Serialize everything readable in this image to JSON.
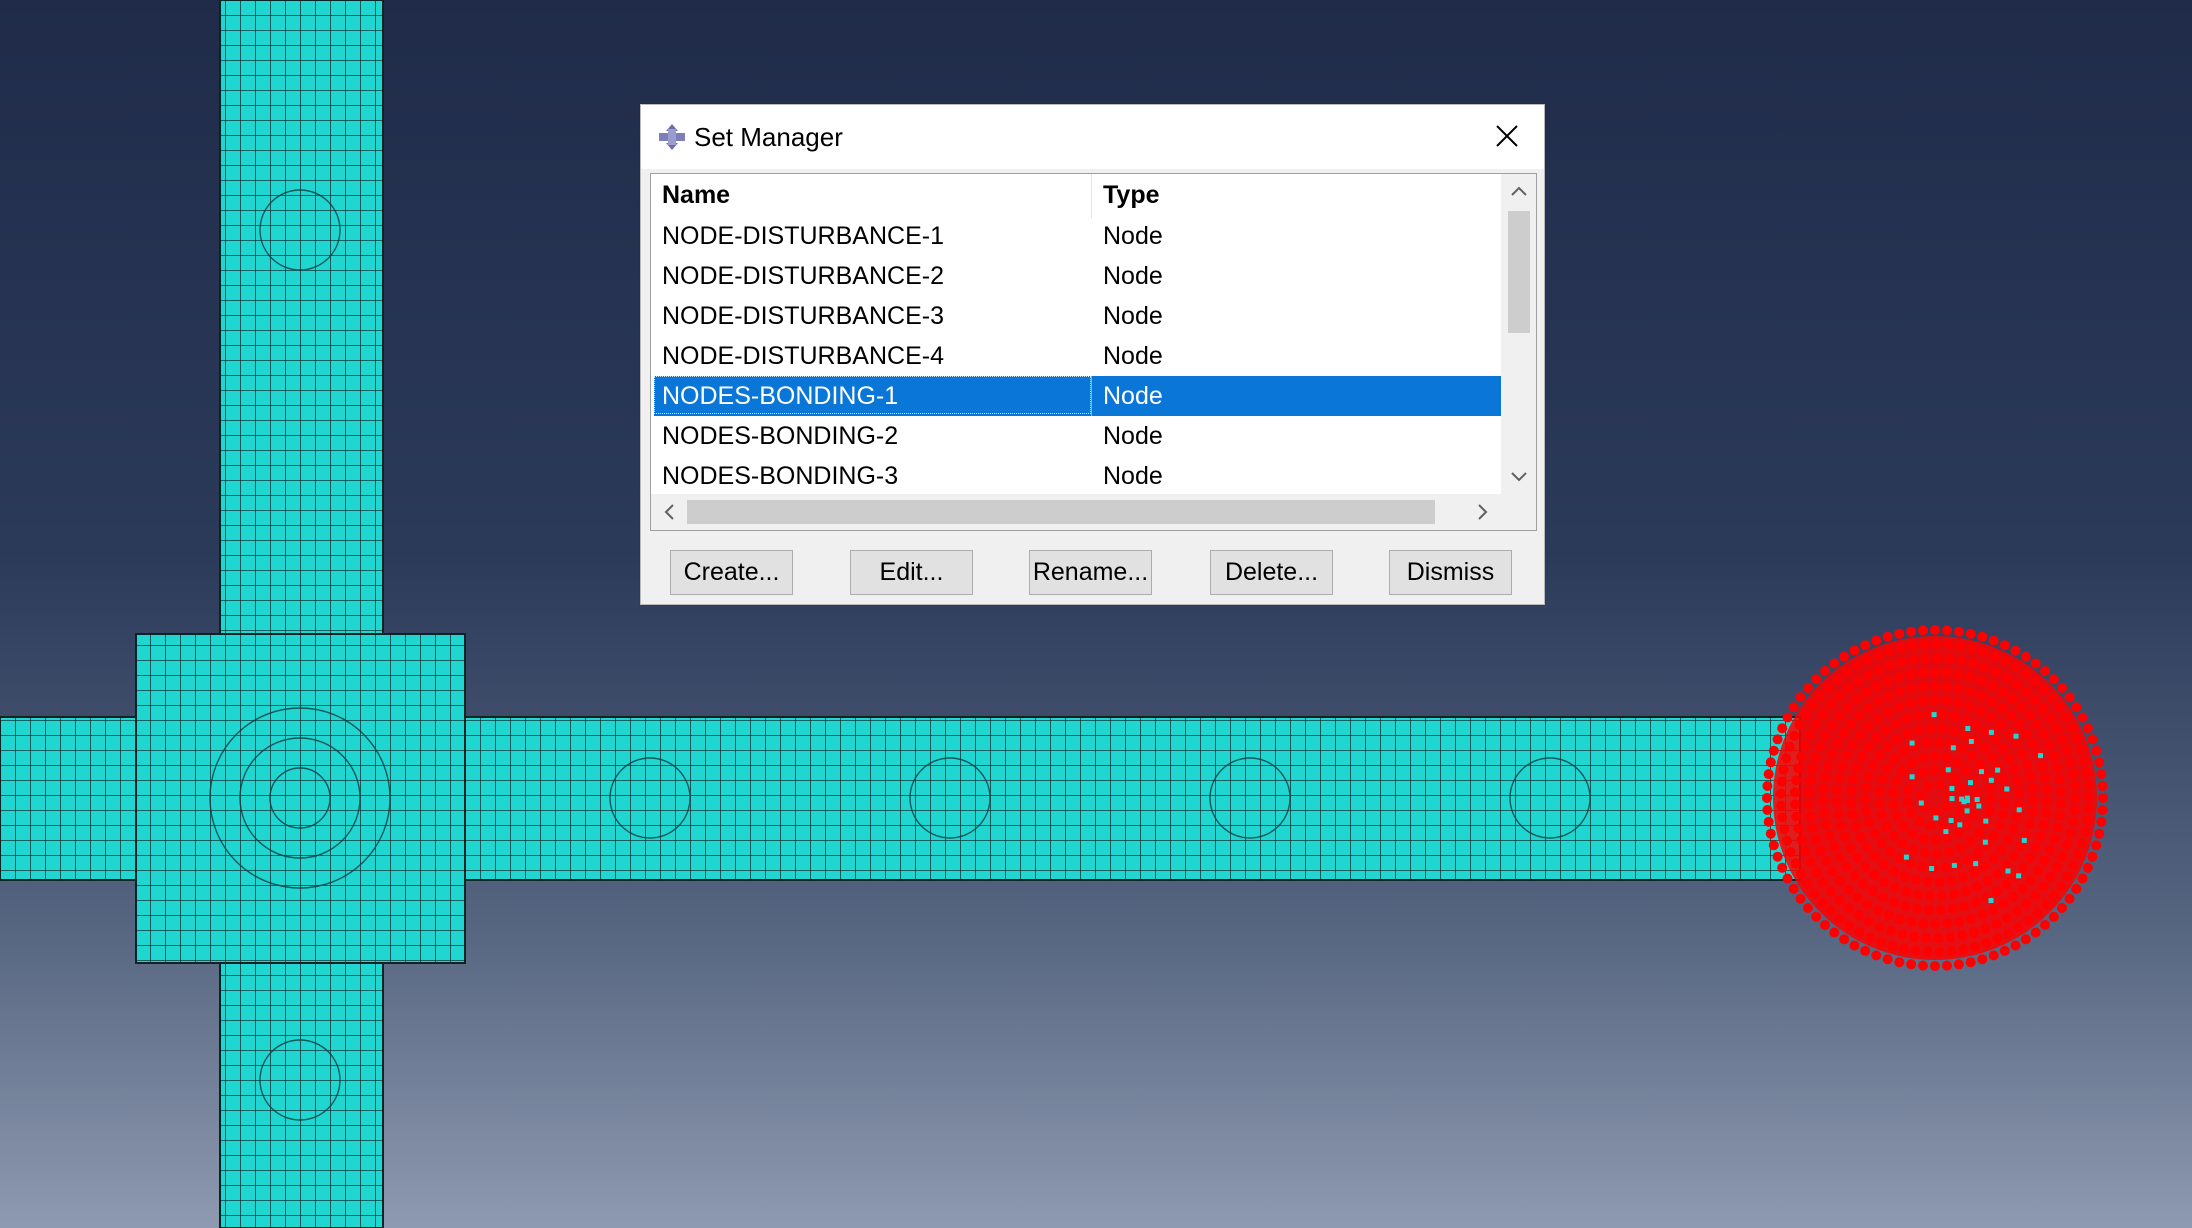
{
  "dialog": {
    "title": "Set Manager",
    "columns": {
      "name": "Name",
      "type": "Type"
    },
    "rows": [
      {
        "name": "NODE-DISTURBANCE-1",
        "type": "Node"
      },
      {
        "name": "NODE-DISTURBANCE-2",
        "type": "Node"
      },
      {
        "name": "NODE-DISTURBANCE-3",
        "type": "Node"
      },
      {
        "name": "NODE-DISTURBANCE-4",
        "type": "Node"
      },
      {
        "name": "NODES-BONDING-1",
        "type": "Node",
        "selected": true
      },
      {
        "name": "NODES-BONDING-2",
        "type": "Node"
      },
      {
        "name": "NODES-BONDING-3",
        "type": "Node"
      }
    ],
    "buttons": {
      "create": "Create...",
      "edit": "Edit...",
      "rename": "Rename...",
      "delete": "Delete...",
      "dismiss": "Dismiss"
    }
  },
  "viewport": {
    "background_colors": [
      "#1f2b49",
      "#8e9ab1"
    ],
    "mesh_color": "#1fd6d1",
    "selected_nodes_color": "#ff0000"
  },
  "icons": {
    "title": "abaqus-logo-icon",
    "close": "close-icon",
    "scroll_up": "chevron-up-icon",
    "scroll_down": "chevron-down-icon",
    "scroll_left": "chevron-left-icon",
    "scroll_right": "chevron-right-icon"
  }
}
